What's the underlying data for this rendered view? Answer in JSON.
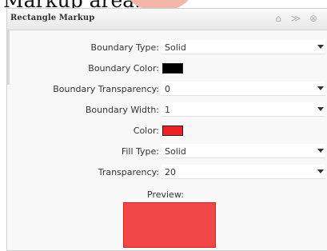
{
  "background": {
    "caption_text": "Markup area."
  },
  "panel": {
    "title": "Rectangle Markup",
    "icons": [
      "up-arrow-icon",
      "double-arrow-icon",
      "close-icon"
    ],
    "fields": {
      "boundary_type": {
        "label": "Boundary Type:",
        "value": "Solid"
      },
      "boundary_color": {
        "label": "Boundary Color:",
        "color": "#000000"
      },
      "boundary_transparency": {
        "label": "Boundary Transparency:",
        "value": "0"
      },
      "boundary_width": {
        "label": "Boundary Width:",
        "value": "1"
      },
      "color": {
        "label": "Color:",
        "color": "#ee2222"
      },
      "fill_type": {
        "label": "Fill Type:",
        "value": "Solid"
      },
      "transparency": {
        "label": "Transparency:",
        "value": "20"
      }
    },
    "preview": {
      "label": "Preview:",
      "fill_color": "#f04848",
      "border_color": "#dd2222"
    }
  }
}
